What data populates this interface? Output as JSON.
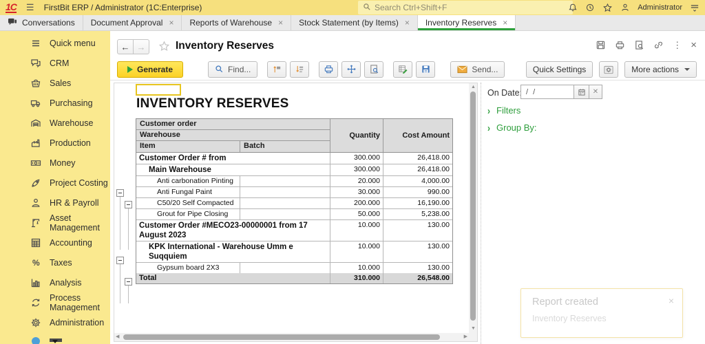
{
  "topbar": {
    "logo": "1C",
    "app_title": "FirstBit ERP / Administrator  (1C:Enterprise)",
    "search_placeholder": "Search Ctrl+Shift+F",
    "user_name": "Administrator"
  },
  "tabs": [
    {
      "label": "Conversations",
      "icon": "chat-icon",
      "closable": false,
      "active": false
    },
    {
      "label": "Document Approval",
      "closable": true,
      "active": false
    },
    {
      "label": "Reports of Warehouse",
      "closable": true,
      "active": false
    },
    {
      "label": "Stock Statement (by Items)",
      "closable": true,
      "active": false
    },
    {
      "label": "Inventory Reserves",
      "closable": true,
      "active": true
    }
  ],
  "sidebar": {
    "items": [
      {
        "label": "Quick menu",
        "icon": "menu-icon"
      },
      {
        "label": "CRM",
        "icon": "chat-bubbles-icon"
      },
      {
        "label": "Sales",
        "icon": "basket-icon"
      },
      {
        "label": "Purchasing",
        "icon": "truck-icon"
      },
      {
        "label": "Warehouse",
        "icon": "warehouse-icon"
      },
      {
        "label": "Production",
        "icon": "factory-icon"
      },
      {
        "label": "Money",
        "icon": "banknote-icon"
      },
      {
        "label": "Project Costing",
        "icon": "rocket-icon"
      },
      {
        "label": "HR & Payroll",
        "icon": "person-icon"
      },
      {
        "label": "Asset Management",
        "icon": "crane-icon"
      },
      {
        "label": "Accounting",
        "icon": "calculator-icon"
      },
      {
        "label": "Taxes",
        "icon": "percent-icon"
      },
      {
        "label": "Analysis",
        "icon": "bar-chart-icon"
      },
      {
        "label": "Process Management",
        "icon": "cycle-icon"
      },
      {
        "label": "Administration",
        "icon": "gear-icon"
      }
    ]
  },
  "window": {
    "title": "Inventory Reserves"
  },
  "toolbar": {
    "generate": "Generate",
    "find": "Find...",
    "send": "Send...",
    "quick_settings": "Quick Settings",
    "more_actions": "More actions"
  },
  "report": {
    "title": "INVENTORY RESERVES",
    "columns": {
      "group1": "Customer order",
      "group2": "Warehouse",
      "group3": "Item",
      "batch": "Batch",
      "quantity": "Quantity",
      "cost_amount": "Cost Amount"
    },
    "rows": [
      {
        "label": "Customer Order # from",
        "level": 0,
        "group": true,
        "quantity": "300.000",
        "cost_amount": "26,418.00"
      },
      {
        "label": "Main Warehouse",
        "level": 1,
        "group": true,
        "quantity": "300.000",
        "cost_amount": "26,418.00"
      },
      {
        "label": "Anti carbonation Pinting",
        "level": 2,
        "group": false,
        "quantity": "20.000",
        "cost_amount": "4,000.00"
      },
      {
        "label": "Anti Fungal Paint",
        "level": 2,
        "group": false,
        "quantity": "30.000",
        "cost_amount": "990.00"
      },
      {
        "label": "C50/20 Self Compacted",
        "level": 2,
        "group": false,
        "quantity": "200.000",
        "cost_amount": "16,190.00"
      },
      {
        "label": "Grout for Pipe Closing",
        "level": 2,
        "group": false,
        "quantity": "50.000",
        "cost_amount": "5,238.00"
      },
      {
        "label": "Customer Order #MECO23-00000001 from 17 August 2023",
        "level": 0,
        "group": true,
        "quantity": "10.000",
        "cost_amount": "130.00"
      },
      {
        "label": "KPK International - Warehouse Umm e Suqquiem",
        "level": 1,
        "group": true,
        "quantity": "10.000",
        "cost_amount": "130.00"
      },
      {
        "label": "Gypsum board 2X3",
        "level": 2,
        "group": false,
        "quantity": "10.000",
        "cost_amount": "130.00"
      }
    ],
    "total": {
      "label": "Total",
      "quantity": "310.000",
      "cost_amount": "26,548.00"
    }
  },
  "panel": {
    "on_date_label": "On Date:",
    "on_date_placeholder": "/ /",
    "filters": "Filters",
    "group_by": "Group By:"
  },
  "notification": {
    "title": "Report created",
    "message": "Inventory Reserves"
  },
  "colors": {
    "accent_green": "#2E9E3C",
    "brand_red": "#D6222A",
    "topbar_yellow": "#F6E07E",
    "sidebar_yellow": "#FAE98F",
    "generate_yellow": "#FBD226",
    "icon_blue": "#4379BD",
    "icon_orange": "#E2933A"
  }
}
